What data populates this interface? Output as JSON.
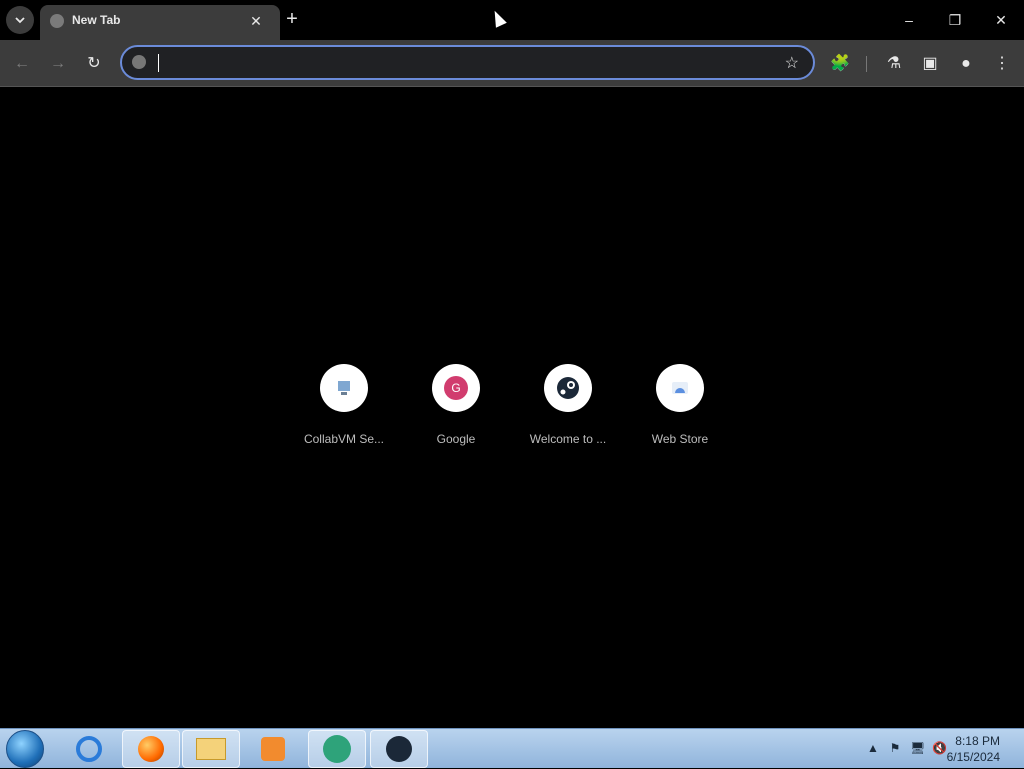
{
  "tab": {
    "title": "New Tab"
  },
  "window_controls": {
    "minimize": "–",
    "restore": "❐",
    "close": "✕"
  },
  "toolbar": {
    "back": "←",
    "forward": "→",
    "reload": "↻",
    "star": "☆",
    "extensions": "🧩",
    "labs": "⚗",
    "sidepanel": "▣",
    "profile": "●",
    "menu": "⋮"
  },
  "omnibox": {
    "value": ""
  },
  "shortcuts": [
    {
      "label": "CollabVM Se...",
      "icon": "collabvm-icon"
    },
    {
      "label": "Google",
      "icon": "google-icon",
      "letter": "G"
    },
    {
      "label": "Welcome to ...",
      "icon": "steam-icon"
    },
    {
      "label": "Web Store",
      "icon": "webstore-icon"
    }
  ],
  "taskbar": {
    "items": [
      "ie-icon",
      "firefox-icon",
      "explorer-icon",
      "media-player-icon",
      "app-icon",
      "steam-icon"
    ],
    "clock": {
      "time": "8:18 PM",
      "date": "6/15/2024"
    }
  },
  "colors": {
    "toolbar_bg": "#3c3c3c",
    "omnibox_border": "#6b8bd9",
    "google_badge": "#d13c6e",
    "steam_dark": "#1b2838"
  }
}
